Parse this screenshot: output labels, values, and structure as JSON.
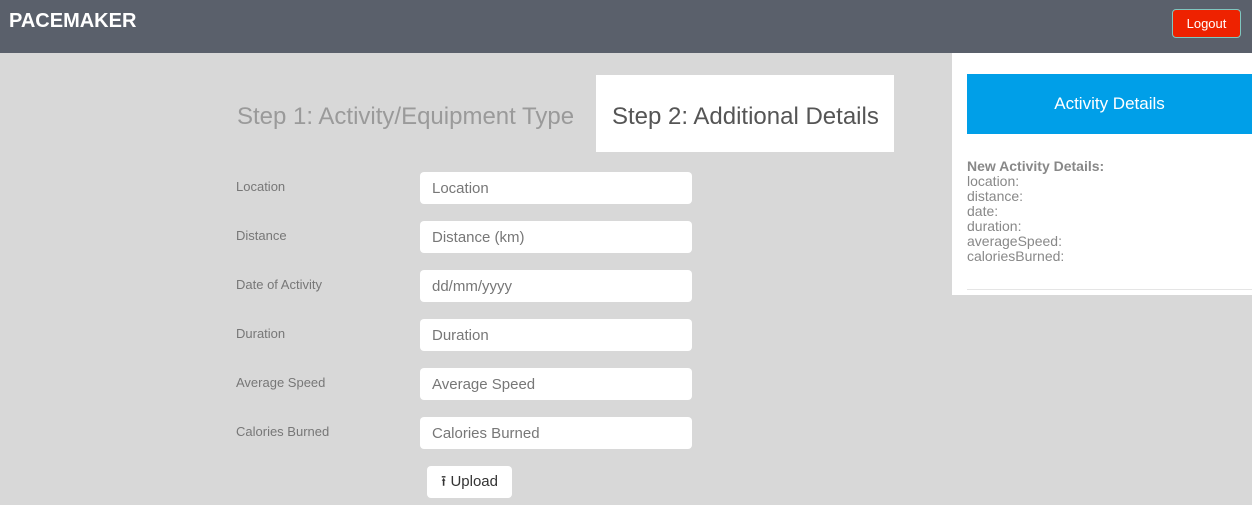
{
  "navbar": {
    "brand": "PACEMAKER",
    "logout": "Logout"
  },
  "tabs": [
    {
      "label": "Step 1: Activity/Equipment Type",
      "active": false
    },
    {
      "label": "Step 2: Additional Details",
      "active": true
    }
  ],
  "form": {
    "fields": [
      {
        "label": "Location",
        "placeholder": "Location"
      },
      {
        "label": "Distance",
        "placeholder": "Distance (km)"
      },
      {
        "label": "Date of Activity",
        "placeholder": "dd/mm/yyyy"
      },
      {
        "label": "Duration",
        "placeholder": "Duration"
      },
      {
        "label": "Average Speed",
        "placeholder": "Average Speed"
      },
      {
        "label": "Calories Burned",
        "placeholder": "Calories Burned"
      }
    ],
    "upload": "Upload"
  },
  "panel": {
    "header": "Activity Details",
    "title": "New Activity Details:",
    "lines": [
      "location:",
      "distance:",
      "date:",
      "duration:",
      "averageSpeed:",
      "caloriesBurned:"
    ]
  },
  "colors": {
    "navbar": "#5a606b",
    "logout": "#ee2200",
    "header": "#009fe8"
  }
}
